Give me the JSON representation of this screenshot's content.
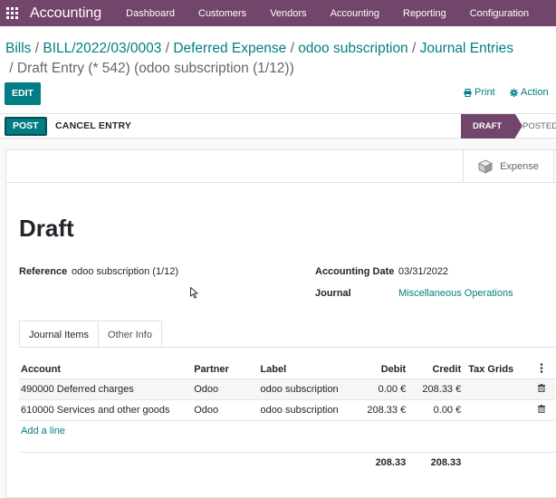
{
  "navbar": {
    "app_name": "Accounting",
    "menu": [
      "Dashboard",
      "Customers",
      "Vendors",
      "Accounting",
      "Reporting",
      "Configuration"
    ]
  },
  "breadcrumb": {
    "items": [
      "Bills",
      "BILL/2022/03/0003",
      "Deferred Expense",
      "odoo subscription",
      "Journal Entries"
    ],
    "current": "Draft Entry (* 542) (odoo subscription (1/12))"
  },
  "control": {
    "edit_label": "EDIT",
    "print_label": "Print",
    "action_label": "Action"
  },
  "statusbar": {
    "post_label": "POST",
    "cancel_label": "CANCEL ENTRY",
    "stages": [
      "DRAFT",
      "POSTED"
    ]
  },
  "smart_button": {
    "expense_label": "Expense"
  },
  "form": {
    "title": "Draft",
    "reference_label": "Reference",
    "reference_value": "odoo subscription (1/12)",
    "accounting_date_label": "Accounting Date",
    "accounting_date_value": "03/31/2022",
    "journal_label": "Journal",
    "journal_value": "Miscellaneous Operations"
  },
  "tabs": [
    "Journal Items",
    "Other Info"
  ],
  "table": {
    "headers": [
      "Account",
      "Partner",
      "Label",
      "Debit",
      "Credit",
      "Tax Grids"
    ],
    "rows": [
      {
        "account": "490000 Deferred charges",
        "partner": "Odoo",
        "label": "odoo subscription",
        "debit": "0.00 €",
        "credit": "208.33 €"
      },
      {
        "account": "610000 Services and other goods",
        "partner": "Odoo",
        "label": "odoo subscription",
        "debit": "208.33 €",
        "credit": "0.00 €"
      }
    ],
    "add_line": "Add a line",
    "total_debit": "208.33",
    "total_credit": "208.33"
  },
  "colors": {
    "brand": "#71466a",
    "accent": "#017e84"
  }
}
